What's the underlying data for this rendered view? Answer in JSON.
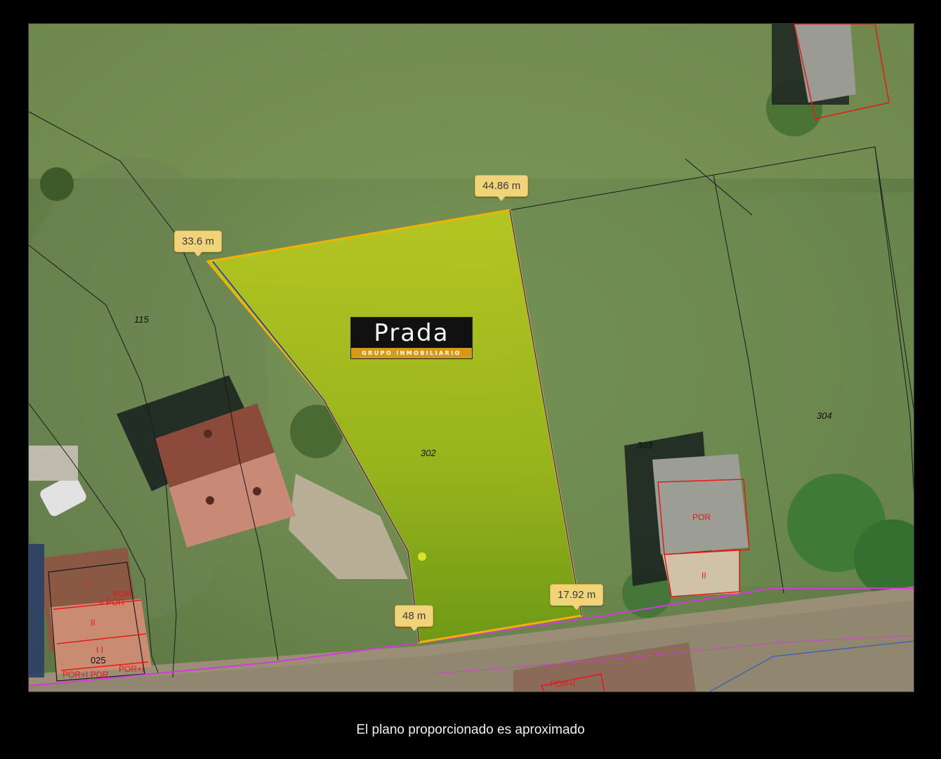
{
  "measurements": {
    "top_edge": "44.86 m",
    "left_edge": "33.6 m",
    "bottom_left": "48 m",
    "bottom_right": "17.92 m"
  },
  "parcels": {
    "p115": "115",
    "p302": "302",
    "p303": "303",
    "p304": "304"
  },
  "buildings": {
    "left_top": "I",
    "left_por": "POR",
    "left_iipor": "II POR",
    "left_ii": "II",
    "left_hi": "I I",
    "left_code": "025",
    "left_porbottom": "POR+I POR",
    "left_porright": "POR+I",
    "right_por": "POR",
    "right_ii": "II",
    "bottom_por": "POR+I"
  },
  "logo": {
    "name": "Prada",
    "tagline": "GRUPO INMOBILIARIO"
  },
  "caption": "El plano proporcionado es aproximado",
  "colors": {
    "parcel_fill": "#a6bf1c",
    "parcel_outline": "#f0b400",
    "boundary_black": "#1a1a1a",
    "building_outline": "#e21a1a",
    "road_line": "#d23bd8"
  }
}
